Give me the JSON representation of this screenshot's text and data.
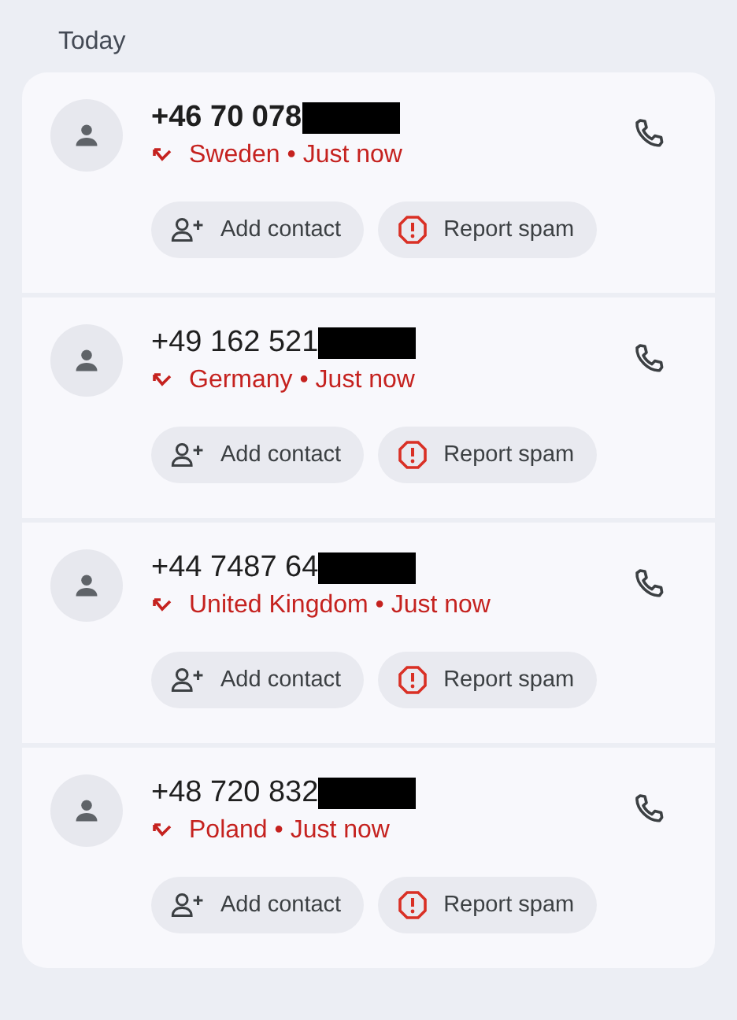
{
  "section": {
    "title": "Today"
  },
  "calls": [
    {
      "number": "+46 70 078",
      "unread": true,
      "kind": "missed",
      "detail": "Sweden • Just now",
      "actions": [
        "Add contact",
        "Report spam"
      ]
    },
    {
      "number": "+49 162 521",
      "unread": false,
      "kind": "missed",
      "detail": "Germany • Just now",
      "actions": [
        "Add contact",
        "Report spam"
      ]
    },
    {
      "number": "+44 7487 64",
      "unread": false,
      "kind": "missed",
      "detail": "United Kingdom • Just now",
      "actions": [
        "Add contact",
        "Report spam"
      ]
    },
    {
      "number": "+48 720 832",
      "unread": false,
      "kind": "missed",
      "detail": "Poland • Just now",
      "actions": [
        "Add contact",
        "Report spam"
      ]
    }
  ]
}
